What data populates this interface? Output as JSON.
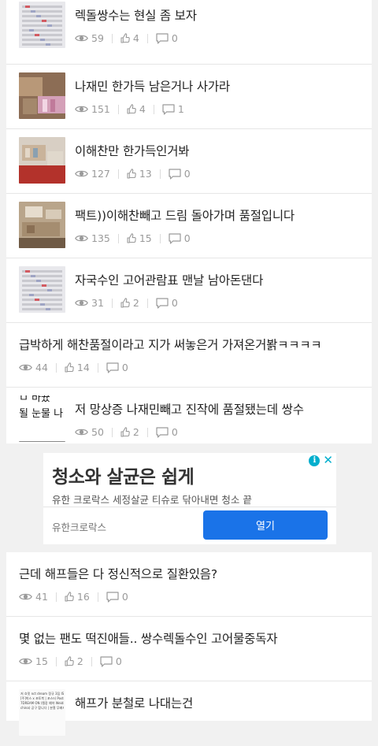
{
  "posts": [
    {
      "title": "렉돌쌍수는 현실 좀 보자",
      "views": "59",
      "likes": "4",
      "comments": "0",
      "thumb": "sheet"
    },
    {
      "title": "나재민 한가득 남은거나 사가라",
      "views": "151",
      "likes": "4",
      "comments": "1",
      "thumb": "boxes-pink"
    },
    {
      "title": "이해찬만 한가득인거봐",
      "views": "127",
      "likes": "13",
      "comments": "0",
      "thumb": "boxes-red"
    },
    {
      "title": "팩트))이해찬빼고 드림 돌아가며 품절입니다",
      "views": "135",
      "likes": "15",
      "comments": "0",
      "thumb": "boxes-beige"
    },
    {
      "title": "자국수인 고어관람표 맨날 남아돈댄다",
      "views": "31",
      "likes": "2",
      "comments": "0",
      "thumb": "sheet"
    },
    {
      "title": "급박하게 해찬품절이라고 지가 써놓은거 가져온거봙ㅋㅋㅋㅋ",
      "views": "44",
      "likes": "14",
      "comments": "0",
      "thumb": ""
    },
    {
      "title": "저 망상증 나재민빼고 진작에 품절됐는데 쌍수",
      "views": "50",
      "likes": "2",
      "comments": "0",
      "thumb": "text-crop",
      "thumb_text": [
        "ㅁ 바뀼",
        "될 눈물 나"
      ]
    }
  ],
  "posts_after_ad": [
    {
      "title": "근데 해프들은 다 정신적으로 질환있음?",
      "views": "41",
      "likes": "16",
      "comments": "0",
      "thumb": ""
    },
    {
      "title": "몇 없는 팬도 떡진애들.. 쌍수렉돌수인 고어물중독자",
      "views": "15",
      "likes": "2",
      "comments": "0",
      "thumb": ""
    },
    {
      "title": "해프가 분철로 나대는건",
      "views": "",
      "likes": "",
      "comments": "",
      "thumb": "text-doc",
      "thumb_text": [
        "저 흐릿 nct dream 정규 3집 ISTJ",
        "[주]박스 x 포토북 | 포스터 Poster",
        "7DREAM ON (팽장 예약 Weidi",
        "china) 공구 합니다 | 분철 무배포"
      ]
    }
  ],
  "ad": {
    "headline": "청소와 살균은 쉽게",
    "description": "유한 크로락스 세정살균 티슈로 닦아내면 청소 끝",
    "sponsor": "유한크로락스",
    "cta": "열기",
    "info_icon": "info-icon",
    "close_icon": "close-icon"
  },
  "colors": {
    "accent": "#1a73e8",
    "adchoices": "#00aecd",
    "meta": "#9a9a9a"
  }
}
